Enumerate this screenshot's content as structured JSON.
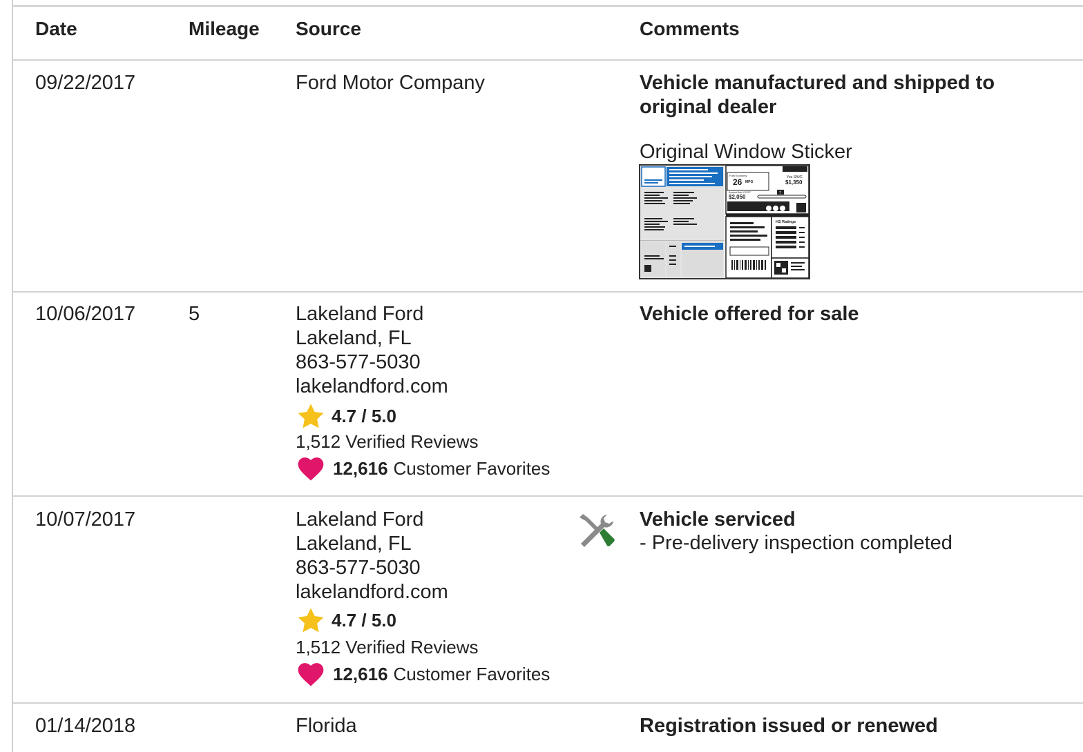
{
  "table": {
    "headers": {
      "date": "Date",
      "mileage": "Mileage",
      "source": "Source",
      "comments": "Comments"
    },
    "rows": [
      {
        "date": "09/22/2017",
        "mileage": "",
        "source": {
          "name": "Ford Motor Company"
        },
        "comment_title": "Vehicle manufactured and shipped to original dealer",
        "sticker_link": "Original Window Sticker",
        "sticker": {
          "mpg_label": "Fuel Economy",
          "mpg": "26",
          "mpg_unit": "MPG",
          "save_label": "You SAVE",
          "save": "$1,350",
          "annual_cost_label": "Annual fuel COST",
          "annual_cost": "$2,050",
          "scale_value": "7",
          "ratings_title": "HS Ratings"
        }
      },
      {
        "date": "10/06/2017",
        "mileage": "5",
        "source": {
          "name": "Lakeland Ford",
          "location": "Lakeland, FL",
          "phone": "863-577-5030",
          "website": "lakelandford.com",
          "rating": "4.7 / 5.0",
          "reviews": "1,512 Verified Reviews",
          "favorites_count": "12,616",
          "favorites_label": "Customer Favorites"
        },
        "comment_title": "Vehicle offered for sale"
      },
      {
        "date": "10/07/2017",
        "mileage": "",
        "icon": "service-tools-icon",
        "source": {
          "name": "Lakeland Ford",
          "location": "Lakeland, FL",
          "phone": "863-577-5030",
          "website": "lakelandford.com",
          "rating": "4.7 / 5.0",
          "reviews": "1,512 Verified Reviews",
          "favorites_count": "12,616",
          "favorites_label": "Customer Favorites"
        },
        "comment_title": "Vehicle serviced",
        "comment_detail": "- Pre-delivery inspection completed"
      },
      {
        "date": "01/14/2018",
        "mileage": "",
        "source": {
          "name": "Florida"
        },
        "comment_title": "Registration issued or renewed"
      }
    ]
  },
  "colors": {
    "star": "#f5c11a",
    "heart": "#e0166a",
    "sticker_blue": "#1a6fc2",
    "wrench_gray": "#8a8a8a",
    "screwdriver_green": "#2e7d32",
    "divider": "#d2d2d2"
  }
}
